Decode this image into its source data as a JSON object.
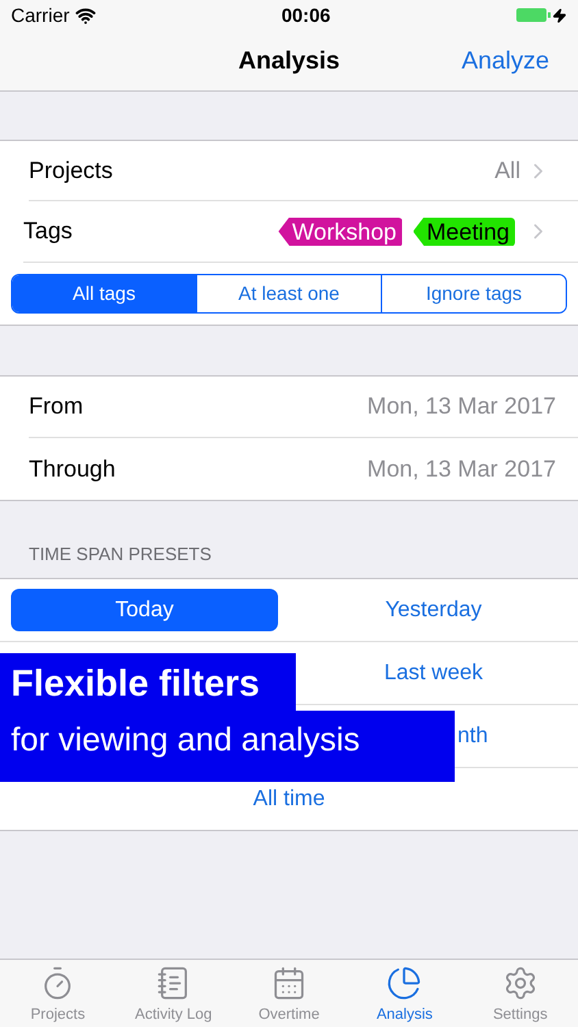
{
  "status_bar": {
    "carrier": "Carrier",
    "time": "00:06"
  },
  "nav": {
    "title": "Analysis",
    "action": "Analyze"
  },
  "filters": {
    "projects": {
      "label": "Projects",
      "value": "All"
    },
    "tags": {
      "label": "Tags",
      "items": [
        {
          "label": "Workshop",
          "color": "#d1139e"
        },
        {
          "label": "Meeting",
          "color": "#22e400"
        }
      ]
    },
    "segments": [
      {
        "label": "All tags",
        "selected": true
      },
      {
        "label": "At least one",
        "selected": false
      },
      {
        "label": "Ignore tags",
        "selected": false
      }
    ]
  },
  "dates": [
    {
      "label": "From",
      "value": "Mon, 13 Mar 2017"
    },
    {
      "label": "Through",
      "value": "Mon, 13 Mar 2017"
    }
  ],
  "presets": {
    "header": "TIME SPAN PRESETS",
    "rows": [
      [
        {
          "label": "Today",
          "selected": true,
          "kind": "left"
        },
        {
          "label": "Yesterday",
          "selected": false,
          "kind": "right"
        }
      ],
      [
        {
          "label": "Last week",
          "selected": false,
          "kind": "right"
        }
      ],
      [
        {
          "label": "nth",
          "selected": false,
          "kind": "cut"
        }
      ],
      [
        {
          "label": "All time",
          "selected": false,
          "kind": "wide"
        }
      ]
    ]
  },
  "banner": {
    "title": "Flexible filters",
    "subtitle": "for viewing and analysis"
  },
  "tab_bar": [
    {
      "label": "Projects",
      "kind": "timer",
      "selected": false
    },
    {
      "label": "Activity Log",
      "kind": "log",
      "selected": false
    },
    {
      "label": "Overtime",
      "kind": "calendar",
      "selected": false
    },
    {
      "label": "Analysis",
      "kind": "pie",
      "selected": true
    },
    {
      "label": "Settings",
      "kind": "gear",
      "selected": false
    }
  ]
}
